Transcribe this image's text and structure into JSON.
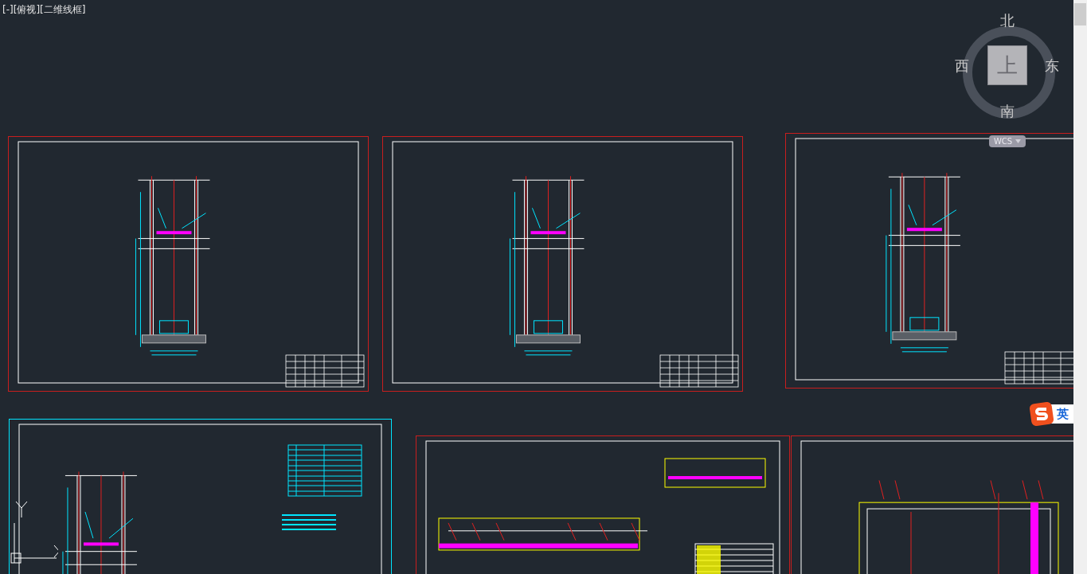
{
  "viewport_controls": [
    {
      "label": "[-]"
    },
    {
      "label": "[俯视]"
    },
    {
      "label": "[二维线框]"
    }
  ],
  "viewcube": {
    "face": "上",
    "north": "北",
    "south": "南",
    "east": "东",
    "west": "西",
    "coordinate_system": "WCS"
  },
  "sheets": [
    {
      "kind": "section",
      "color": "#c81e1e"
    },
    {
      "kind": "section",
      "color": "#c81e1e"
    },
    {
      "kind": "section",
      "color": "#c81e1e"
    },
    {
      "kind": "section-table",
      "color": "#00e5ff"
    },
    {
      "kind": "plan",
      "color": "#c81e1e"
    },
    {
      "kind": "frame",
      "color": "#c81e1e"
    }
  ],
  "ime": {
    "mode": "英"
  }
}
